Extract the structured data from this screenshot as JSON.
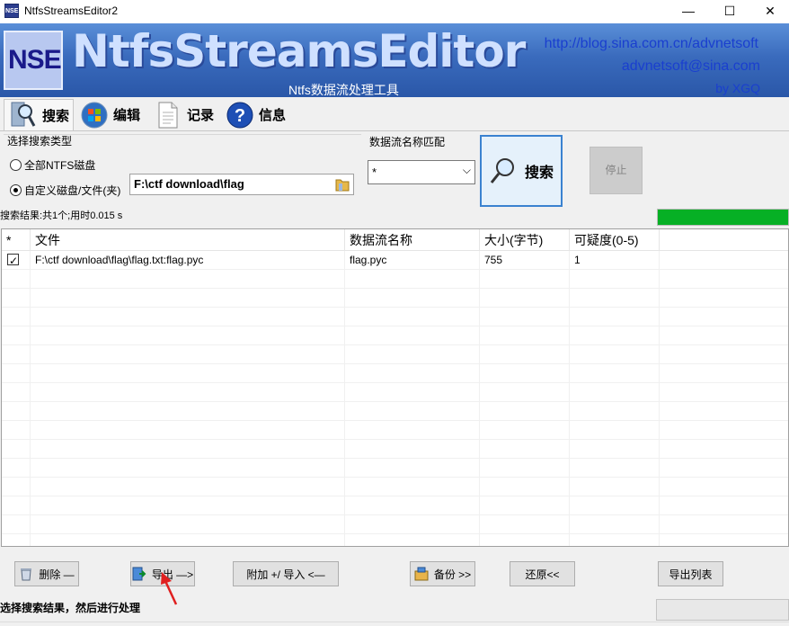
{
  "window": {
    "title": "NtfsStreamsEditor2",
    "app_icon_text": "NSE",
    "minimize": "—",
    "maximize": "☐",
    "close": "✕"
  },
  "banner": {
    "logo": "NSE",
    "brand": "NtfsStreamsEditor",
    "subtitle": "Ntfs数据流处理工具",
    "url": "http://blog.sina.com.cn/advnetsoft",
    "email": "advnetsoft@sina.com",
    "author": "by XGQ"
  },
  "tabs": [
    {
      "label": "搜索",
      "icon": "search-magnifier-icon",
      "active": true
    },
    {
      "label": "编辑",
      "icon": "windows-orb-icon",
      "active": false
    },
    {
      "label": "记录",
      "icon": "document-icon",
      "active": false
    },
    {
      "label": "信息",
      "icon": "help-icon",
      "active": false
    }
  ],
  "search_options": {
    "type_label": "选择搜索类型",
    "radio_all": "全部NTFS磁盘",
    "radio_custom": "自定义磁盘/文件(夹)",
    "path_value": "F:\\ctf download\\flag",
    "name_match_label": "数据流名称匹配",
    "name_match_value": "*",
    "search_button": "搜索",
    "stop_button": "停止"
  },
  "status": {
    "text": "搜索结果:共1个;用时0.015 s",
    "progress": 1.0,
    "progress_color": "#06b025"
  },
  "table": {
    "columns": [
      "*",
      "文件",
      "数据流名称",
      "大小(字节)",
      "可疑度(0-5)"
    ],
    "rows": [
      {
        "checked": true,
        "file": "F:\\ctf download\\flag\\flag.txt:flag.pyc",
        "stream": "flag.pyc",
        "size": "755",
        "suspicion": "1"
      }
    ]
  },
  "buttons": {
    "delete": "删除 —",
    "export": "导出 —>",
    "attach_import": "附加 +/ 导入 <—",
    "backup": "备份 >>",
    "restore": "还原<<",
    "export_list": "导出列表"
  },
  "hint": "选择搜索结果，然后进行处理",
  "colors": {
    "banner_top": "#5a8fd8",
    "banner_bottom": "#2a57a8",
    "link": "#1a3fcf",
    "annotation_arrow": "#e02020"
  }
}
